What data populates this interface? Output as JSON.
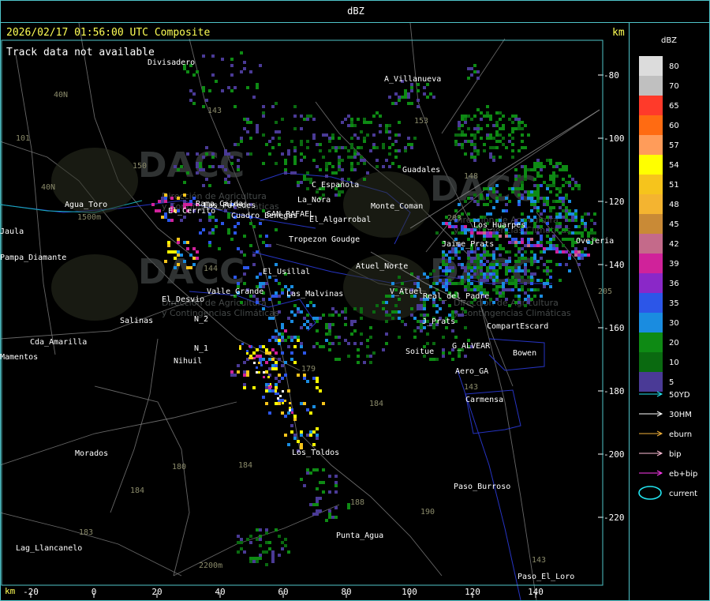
{
  "header": {
    "title": "dBZ"
  },
  "map": {
    "timestamp": "2026/02/17 01:56:00 UTC Composite",
    "track_note": "Track data not available",
    "y_unit": "km",
    "x_unit": "km",
    "y_ticks": [
      "-80",
      "-100",
      "-120",
      "-140",
      "-160",
      "-180",
      "-200",
      "-220"
    ],
    "x_ticks": [
      "-20",
      "0",
      "20",
      "40",
      "60",
      "80",
      "100",
      "120",
      "140"
    ],
    "watermark": {
      "text": "DACC",
      "line1": "Dirección de Agricultura",
      "line2": "y Contingencias Climáticas"
    },
    "places": [
      {
        "name": "Divisadero"
      },
      {
        "name": "A_Villanueva"
      },
      {
        "name": "Guadales"
      },
      {
        "name": "Agua_Toro"
      },
      {
        "name": "Pampa_Diamante"
      },
      {
        "name": "Rama_Caida"
      },
      {
        "name": "SAN_RAFAEL"
      },
      {
        "name": "La_Nora"
      },
      {
        "name": "C_Española"
      },
      {
        "name": "El_Cerrito"
      },
      {
        "name": "Las_Paredes"
      },
      {
        "name": "Cuadro_Benegas"
      },
      {
        "name": "El_Algarrobal"
      },
      {
        "name": "Tropezon"
      },
      {
        "name": "Goudge"
      },
      {
        "name": "Atuel_Norte"
      },
      {
        "name": "El_Usillal"
      },
      {
        "name": "Las_Malvinas"
      },
      {
        "name": "Valle_Grande"
      },
      {
        "name": "El_Desvio"
      },
      {
        "name": "Salinas"
      },
      {
        "name": "Cda_Amarilla"
      },
      {
        "name": "N_1"
      },
      {
        "name": "N_2"
      },
      {
        "name": "Nihuil"
      },
      {
        "name": "Real_del_Padre"
      },
      {
        "name": "V_Atuel"
      },
      {
        "name": "J_Prats"
      },
      {
        "name": "G_ALVEAR"
      },
      {
        "name": "Soitue"
      },
      {
        "name": "CompartEscard"
      },
      {
        "name": "Bowen"
      },
      {
        "name": "Aero_GA"
      },
      {
        "name": "Carmensa"
      },
      {
        "name": "Los_Toldos"
      },
      {
        "name": "Morados"
      },
      {
        "name": "Paso_Burroso"
      },
      {
        "name": "Punta_Agua"
      },
      {
        "name": "Lag_Llancanelo"
      },
      {
        "name": "Paso_El_Loro"
      },
      {
        "name": "Ovejeria"
      },
      {
        "name": "Jaime_Prats"
      },
      {
        "name": "Monte_Coman"
      },
      {
        "name": "Jaula"
      },
      {
        "name": "Mamentos"
      },
      {
        "name": "Los_Huarpes"
      }
    ],
    "route_labels": [
      "40N",
      "40N",
      "101",
      "143",
      "150",
      "153",
      "148",
      "203",
      "144",
      "184",
      "180",
      "184",
      "183",
      "179",
      "188",
      "190",
      "184",
      "205",
      "143",
      "143",
      "2200m",
      "1500m"
    ]
  },
  "legend": {
    "title": "dBZ",
    "scale": [
      {
        "label": "80",
        "color": "#dcdcdc"
      },
      {
        "label": "70",
        "color": "#c0c0c0"
      },
      {
        "label": "65",
        "color": "#ff3a2a"
      },
      {
        "label": "60",
        "color": "#ff6b12"
      },
      {
        "label": "57",
        "color": "#ff9c5a"
      },
      {
        "label": "54",
        "color": "#ffff00"
      },
      {
        "label": "51",
        "color": "#f6c41c"
      },
      {
        "label": "48",
        "color": "#f4b430"
      },
      {
        "label": "45",
        "color": "#c98a36"
      },
      {
        "label": "42",
        "color": "#c46a8a"
      },
      {
        "label": "39",
        "color": "#d0229a"
      },
      {
        "label": "36",
        "color": "#8a28c8"
      },
      {
        "label": "35",
        "color": "#2c56e8"
      },
      {
        "label": "30",
        "color": "#1a8ce0"
      },
      {
        "label": "20",
        "color": "#0e8a14"
      },
      {
        "label": "10",
        "color": "#0a6a10"
      },
      {
        "label": "5",
        "color": "#4a3a96"
      }
    ],
    "tracks": [
      {
        "label": "50YD",
        "color": "#22e6f2"
      },
      {
        "label": "30HM",
        "color": "#ffffff"
      },
      {
        "label": "eburn",
        "color": "#f2b23a"
      },
      {
        "label": "bip",
        "color": "#ffc0d8"
      },
      {
        "label": "eb+bip",
        "color": "#ff3af0"
      },
      {
        "label": "current",
        "color": "#22e6f2"
      }
    ]
  }
}
